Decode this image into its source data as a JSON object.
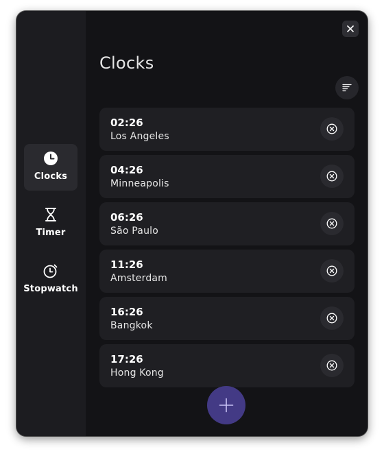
{
  "window": {
    "close_icon": "close-icon"
  },
  "sidebar": {
    "items": [
      {
        "label": "Clocks",
        "icon": "clock-icon",
        "active": true
      },
      {
        "label": "Timer",
        "icon": "hourglass-icon",
        "active": false
      },
      {
        "label": "Stopwatch",
        "icon": "stopwatch-icon",
        "active": false
      }
    ]
  },
  "main": {
    "title": "Clocks",
    "sort_icon": "sort-icon",
    "clocks": [
      {
        "time": "02:26",
        "city": "Los Angeles"
      },
      {
        "time": "04:26",
        "city": "Minneapolis"
      },
      {
        "time": "06:26",
        "city": "São Paulo"
      },
      {
        "time": "11:26",
        "city": "Amsterdam"
      },
      {
        "time": "16:26",
        "city": "Bangkok"
      },
      {
        "time": "17:26",
        "city": "Hong Kong"
      }
    ],
    "remove_icon": "remove-circle-icon",
    "add_icon": "plus-icon"
  },
  "colors": {
    "accent": "#433a85",
    "accent_icon": "#c8c2f5",
    "window_bg": "#131316",
    "sidebar_bg": "#1c1c20",
    "row_bg": "#1f1f23"
  }
}
